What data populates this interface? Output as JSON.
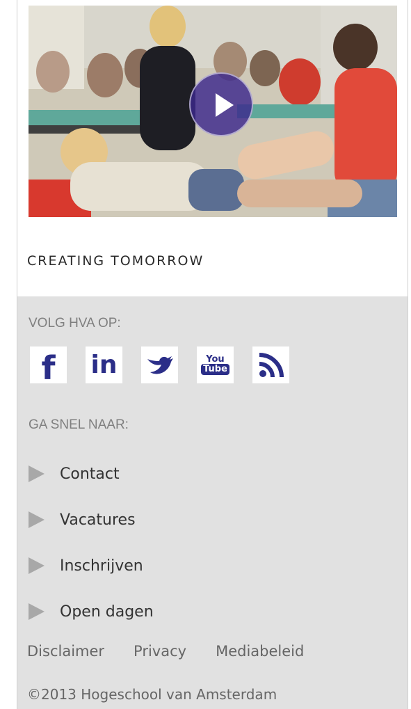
{
  "hero": {
    "play_button": "play-icon",
    "tagline": "CREATING TOMORROW"
  },
  "follow": {
    "label": "VOLG HVA OP:",
    "icons": [
      {
        "name": "facebook-icon",
        "glyph": "f"
      },
      {
        "name": "linkedin-icon",
        "glyph": "in"
      },
      {
        "name": "twitter-icon",
        "glyph": "bird"
      },
      {
        "name": "youtube-icon",
        "glyph_top": "You",
        "glyph_bottom": "Tube"
      },
      {
        "name": "rss-icon",
        "glyph": "rss"
      }
    ]
  },
  "quicklinks": {
    "label": "GA SNEL NAAR:",
    "items": [
      {
        "label": "Contact"
      },
      {
        "label": "Vacatures"
      },
      {
        "label": "Inschrijven"
      },
      {
        "label": "Open dagen"
      }
    ]
  },
  "footer": {
    "links": [
      {
        "label": "Disclaimer"
      },
      {
        "label": "Privacy"
      },
      {
        "label": "Mediabeleid"
      }
    ],
    "copyright": "©2013 Hogeschool van Amsterdam"
  },
  "colors": {
    "brand_icon": "#2b2e88",
    "panel_bg": "#e1e1e1",
    "play_bg": "#3c288c"
  }
}
